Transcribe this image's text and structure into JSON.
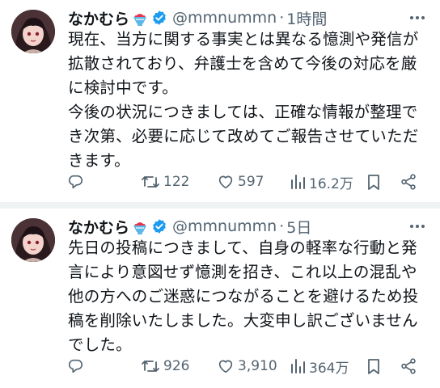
{
  "tweets": [
    {
      "name": "なかむら",
      "handle": "@mmnummn",
      "time": "1時間",
      "text": "現在、当方に関する事実とは異なる憶測や発信が\n拡散されており、弁護士を含めて今後の対応を厳\nに検討中です。\n今後の状況につきましては、正確な情報が整理で\nき次第、必要に応じて改めてご報告させていただ\nきます。",
      "stats": {
        "retweets": "122",
        "likes": "597",
        "views": "16.2万"
      }
    },
    {
      "name": "なかむら",
      "handle": "@mmnummn",
      "time": "5日",
      "text": "先日の投稿につきまして、自身の軽率な行動と発\n言により意図せず憶測を招き、これ以上の混乱や\n他の方へのご迷惑につながることを避けるため投\n稿を削除いたしました。大変申し訳ございません\nでした。",
      "stats": {
        "retweets": "926",
        "likes": "3,910",
        "views": "364万"
      }
    }
  ],
  "separator": "·",
  "colors": {
    "text": "#0f1419",
    "secondary": "#536471",
    "verified": "#1d9bf0",
    "divider": "#eff3f4"
  },
  "icons": [
    "reply-icon",
    "retweet-icon",
    "like-icon",
    "views-icon",
    "bookmark-icon",
    "share-icon",
    "more-icon",
    "verified-badge-icon",
    "shaved-ice-emoji"
  ]
}
